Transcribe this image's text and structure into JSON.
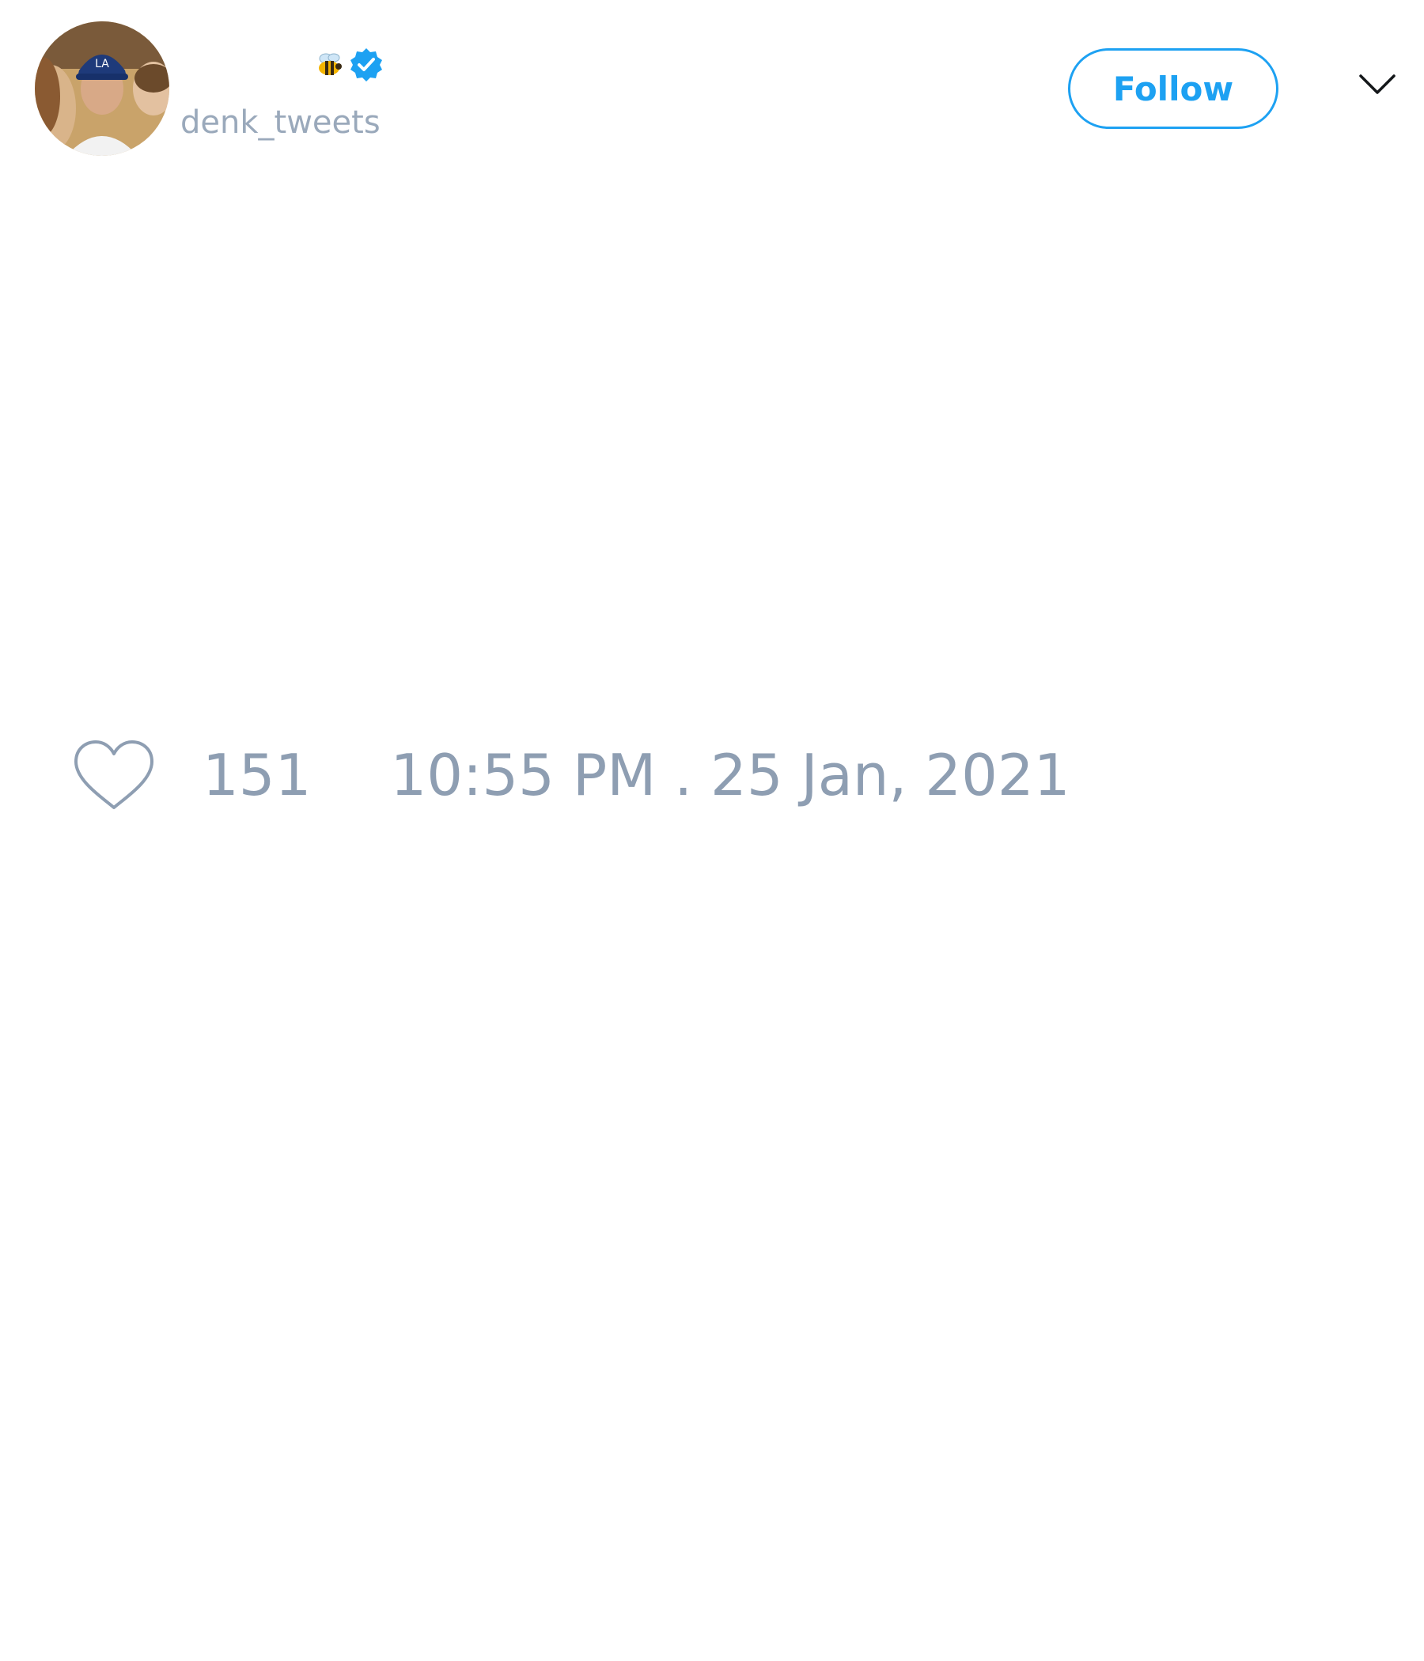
{
  "tweet": {
    "author": {
      "display_name": "",
      "emoji_icon": "bee-icon",
      "verified_icon": "verified-badge-icon",
      "handle": "denk_tweets",
      "avatar": "profile-photo"
    },
    "follow_button_label": "Follow",
    "menu_icon": "chevron-down-icon",
    "like_icon": "heart-icon",
    "like_count": "151",
    "timestamp": "10:55 PM . 25 Jan, 2021"
  },
  "colors": {
    "accent": "#1da1f2",
    "muted_text": "#8e9eb2",
    "handle_text": "#9aa9bb",
    "background": "#ffffff"
  }
}
